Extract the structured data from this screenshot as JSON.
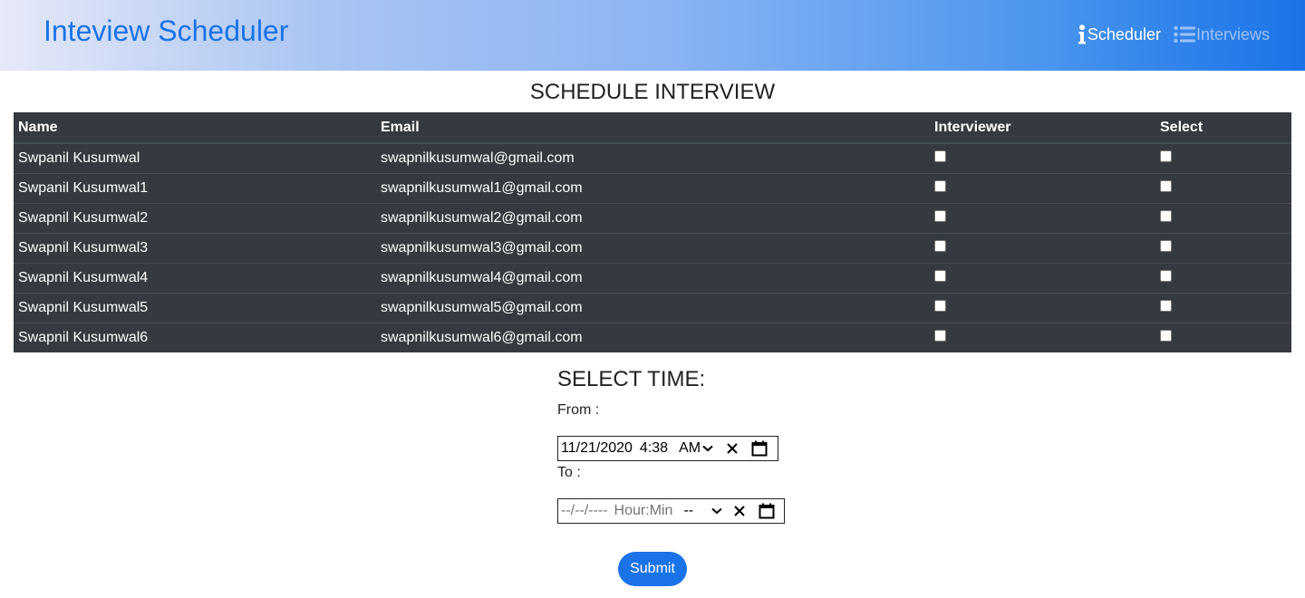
{
  "app": {
    "brand": "Inteview Scheduler",
    "nav": [
      {
        "label": "Scheduler",
        "icon": "info-icon",
        "active": true
      },
      {
        "label": "Interviews",
        "icon": "list-icon",
        "active": false
      }
    ]
  },
  "page_title": "SCHEDULE INTERVIEW",
  "table": {
    "headers": [
      "Name",
      "Email",
      "Interviewer",
      "Select"
    ],
    "rows": [
      {
        "name": "Swpanil Kusumwal",
        "email": "swapnilkusumwal@gmail.com",
        "interviewer": false,
        "select": false
      },
      {
        "name": "Swpanil Kusumwal1",
        "email": "swapnilkusumwal1@gmail.com",
        "interviewer": false,
        "select": false
      },
      {
        "name": "Swapnil Kusumwal2",
        "email": "swapnilkusumwal2@gmail.com",
        "interviewer": false,
        "select": false
      },
      {
        "name": "Swapnil Kusumwal3",
        "email": "swapnilkusumwal3@gmail.com",
        "interviewer": false,
        "select": false
      },
      {
        "name": "Swapnil Kusumwal4",
        "email": "swapnilkusumwal4@gmail.com",
        "interviewer": false,
        "select": false
      },
      {
        "name": "Swapnil Kusumwal5",
        "email": "swapnilkusumwal5@gmail.com",
        "interviewer": false,
        "select": false
      },
      {
        "name": "Swapnil Kusumwal6",
        "email": "swapnilkusumwal6@gmail.com",
        "interviewer": false,
        "select": false
      }
    ]
  },
  "time": {
    "title": "SELECT TIME:",
    "from_label": "From :",
    "to_label": "To :",
    "from": {
      "month": "11",
      "day": "21",
      "year": "2020",
      "hour": "4",
      "minute": "38",
      "ampm": "AM"
    },
    "to": {
      "month": "--",
      "day": "--",
      "year": "----",
      "hour": "Hour",
      "minute": "Min",
      "ampm": "--"
    }
  },
  "submit_label": "Submit",
  "colors": {
    "accent": "#1a73e8",
    "table_bg": "#343a40",
    "nav_inactive": "#9fc1f5"
  }
}
